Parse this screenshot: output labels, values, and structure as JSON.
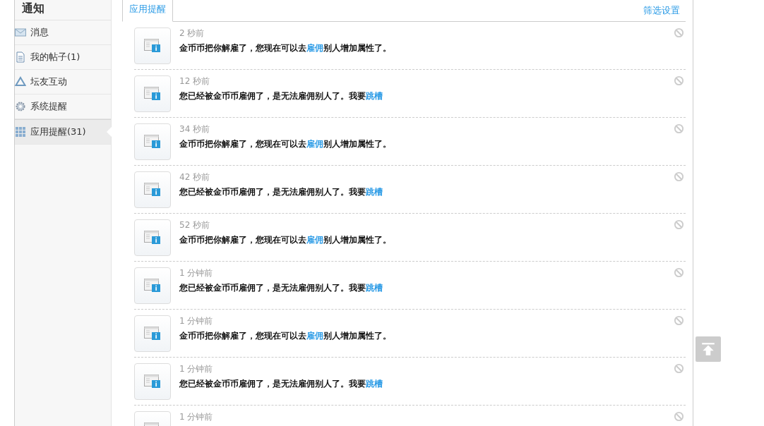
{
  "sidebar": {
    "title": "通知",
    "items": [
      {
        "label": "消息",
        "selected": false
      },
      {
        "label": "我的帖子(1)",
        "selected": false
      },
      {
        "label": "坛友互动",
        "selected": false
      },
      {
        "label": "系统提醒",
        "selected": false
      },
      {
        "label": "应用提醒(31)",
        "selected": true
      }
    ]
  },
  "tabs": [
    {
      "label": "应用提醒",
      "selected": true
    }
  ],
  "filter_link": "筛选设置",
  "notifications": [
    {
      "time": "2 秒前",
      "before": "金币币把你解雇了，您现在可以去",
      "link": "雇佣",
      "after": "别人增加属性了。"
    },
    {
      "time": "12 秒前",
      "before": "您已经被金币币雇佣了，是无法雇佣别人了。我要",
      "link": "跳槽"
    },
    {
      "time": "34 秒前",
      "before": "金币币把你解雇了，您现在可以去",
      "link": "雇佣",
      "after": "别人增加属性了。"
    },
    {
      "time": "42 秒前",
      "before": "您已经被金币币雇佣了，是无法雇佣别人了。我要",
      "link": "跳槽"
    },
    {
      "time": "52 秒前",
      "before": "金币币把你解雇了，您现在可以去",
      "link": "雇佣",
      "after": "别人增加属性了。"
    },
    {
      "time": "1 分钟前",
      "before": "您已经被金币币雇佣了，是无法雇佣别人了。我要",
      "link": "跳槽"
    },
    {
      "time": "1 分钟前",
      "before": "金币币把你解雇了，您现在可以去",
      "link": "雇佣",
      "after": "别人增加属性了。"
    },
    {
      "time": "1 分钟前",
      "before": "您已经被金币币雇佣了，是无法雇佣别人了。我要",
      "link": "跳槽"
    },
    {
      "time": "1 分钟前"
    }
  ]
}
